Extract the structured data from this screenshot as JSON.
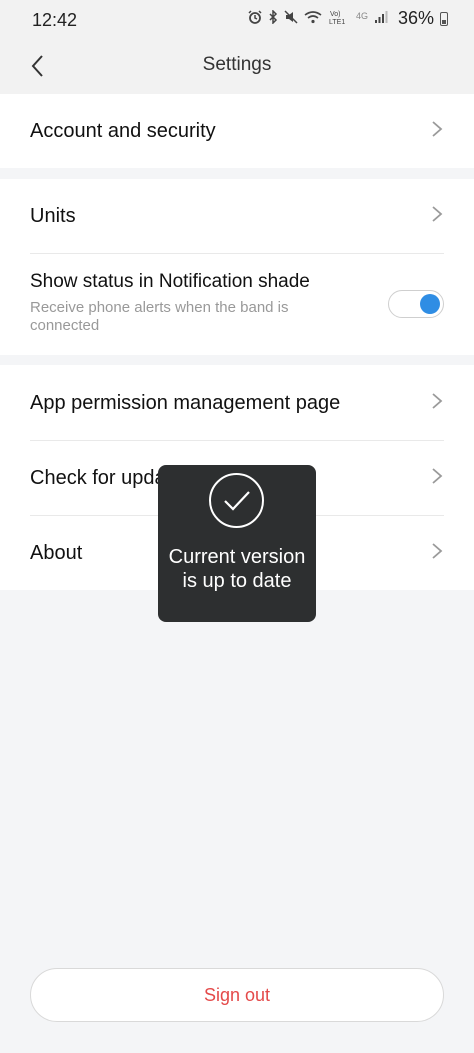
{
  "status_bar": {
    "time": "12:42",
    "battery": "36%",
    "icons": [
      "alarm-icon",
      "bluetooth-icon",
      "mute-icon",
      "wifi-icon",
      "volte-icon",
      "4g-icon",
      "signal-icon",
      "battery-icon"
    ],
    "volte_label": "Vo)\nLTE1",
    "network_label": "4G"
  },
  "header": {
    "title": "Settings",
    "back_icon": "chevron-left-icon"
  },
  "sections": {
    "account": {
      "label": "Account and security"
    },
    "units": {
      "label": "Units"
    },
    "notification": {
      "label": "Show status in Notification shade",
      "description": "Receive phone alerts when the band is connected",
      "enabled": true
    },
    "permissions": {
      "label": "App permission management page"
    },
    "updates": {
      "label": "Check for updates"
    },
    "about": {
      "label": "About"
    }
  },
  "toast": {
    "icon": "check-circle-icon",
    "message": "Current version is up to date"
  },
  "footer": {
    "sign_out_label": "Sign out"
  },
  "colors": {
    "accent": "#2f8de4",
    "sign_out": "#e44a4a",
    "toast_bg": "#2d2f30",
    "page_bg": "#f4f5f7"
  }
}
